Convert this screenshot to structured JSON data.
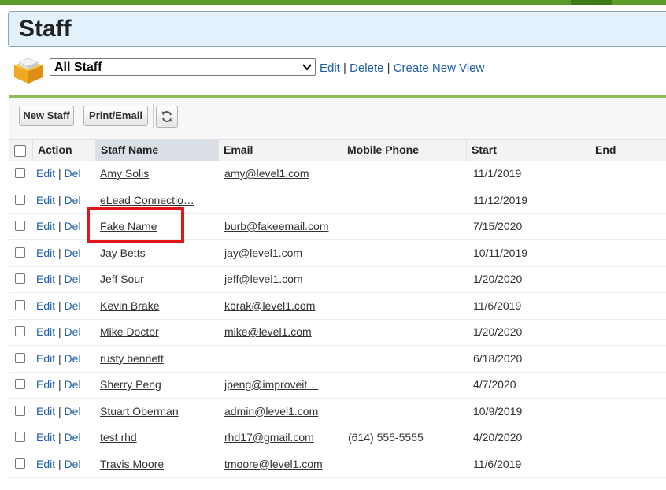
{
  "page": {
    "title": "Staff"
  },
  "view": {
    "selected": "All Staff",
    "links": [
      "Edit",
      "Delete",
      "Create New View"
    ]
  },
  "toolbar": {
    "new_label": "New Staff",
    "print_label": "Print/Email"
  },
  "columns": [
    "Action",
    "Staff Name",
    "Email",
    "Mobile Phone",
    "Start",
    "End"
  ],
  "sorted_column": "Staff Name",
  "action_labels": {
    "edit": "Edit",
    "del": "Del"
  },
  "rows": [
    {
      "name": "Amy Solis",
      "email": "amy@level1.com",
      "phone": "",
      "start": "11/1/2019",
      "end": ""
    },
    {
      "name": "eLead Connectio…",
      "email": "",
      "phone": "",
      "start": "11/12/2019",
      "end": ""
    },
    {
      "name": "Fake Name",
      "email": "burb@fakeemail.com",
      "phone": "",
      "start": "7/15/2020",
      "end": ""
    },
    {
      "name": "Jay Betts",
      "email": "jay@level1.com",
      "phone": "",
      "start": "10/11/2019",
      "end": ""
    },
    {
      "name": "Jeff Sour",
      "email": "jeff@level1.com",
      "phone": "",
      "start": "1/20/2020",
      "end": ""
    },
    {
      "name": "Kevin Brake",
      "email": "kbrak@level1.com",
      "phone": "",
      "start": "11/6/2019",
      "end": ""
    },
    {
      "name": "Mike Doctor",
      "email": "mike@level1.com",
      "phone": "",
      "start": "1/20/2020",
      "end": ""
    },
    {
      "name": "rusty bennett",
      "email": "",
      "phone": "",
      "start": "6/18/2020",
      "end": ""
    },
    {
      "name": "Sherry Peng",
      "email": "jpeng@improveit…",
      "phone": "",
      "start": "4/7/2020",
      "end": ""
    },
    {
      "name": "Stuart Oberman",
      "email": "admin@level1.com",
      "phone": "",
      "start": "10/9/2019",
      "end": ""
    },
    {
      "name": "test rhd",
      "email": "rhd17@gmail.com",
      "phone": "(614) 555-5555",
      "start": "4/20/2020",
      "end": ""
    },
    {
      "name": "Travis Moore",
      "email": "tmoore@level1.com",
      "phone": "",
      "start": "11/6/2019",
      "end": ""
    }
  ],
  "colors": {
    "accent_green": "#8dbb54",
    "link_blue": "#1d5fa8",
    "highlight_red": "#e0161b",
    "header_bg": "#e3f1fd"
  },
  "icons": {
    "view": "box-icon",
    "refresh": "refresh-icon",
    "sort": "sort-ascending-icon"
  }
}
